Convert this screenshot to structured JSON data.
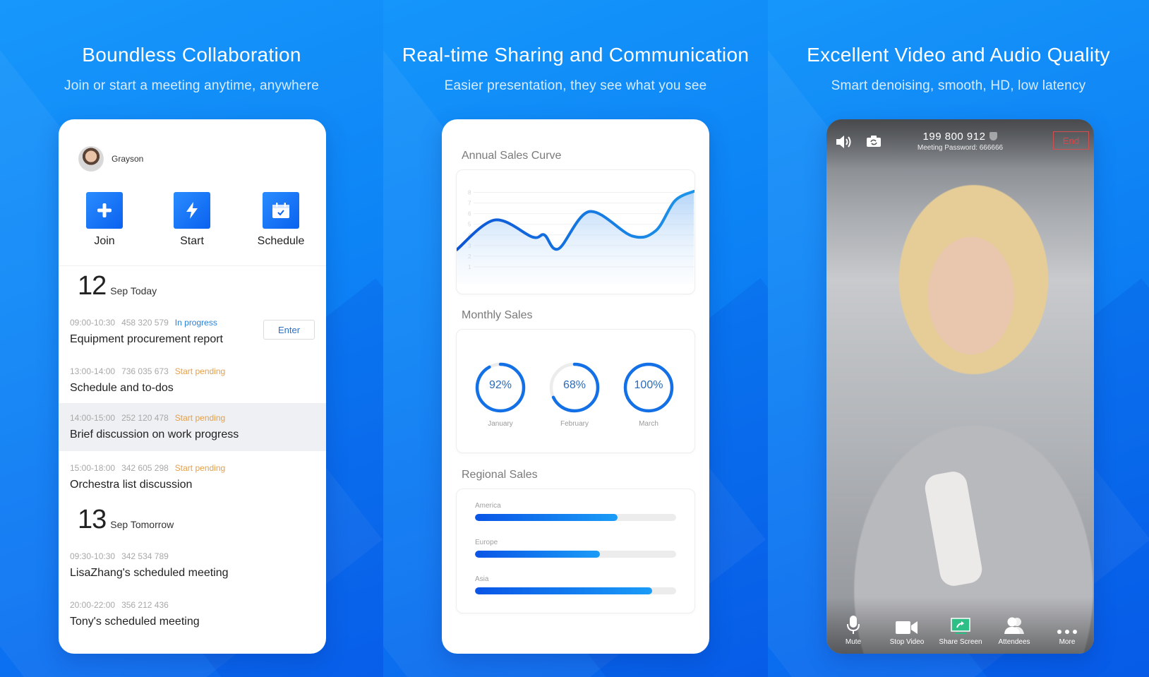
{
  "panels": [
    {
      "title": "Boundless Collaboration",
      "subtitle": "Join or start a meeting anytime, anywhere"
    },
    {
      "title": "Real-time Sharing and Communication",
      "subtitle": "Easier presentation, they see what you see"
    },
    {
      "title": "Excellent Video and Audio Quality",
      "subtitle": "Smart denoising, smooth, HD, low latency"
    }
  ],
  "home": {
    "user": {
      "name": "Grayson",
      "avatar_icon": "user-avatar"
    },
    "actions": [
      {
        "label": "Join",
        "icon": "plus-icon"
      },
      {
        "label": "Start",
        "icon": "lightning-icon"
      },
      {
        "label": "Schedule",
        "icon": "calendar-icon"
      }
    ],
    "days": [
      {
        "day": "12",
        "label": "Sep Today",
        "meetings": [
          {
            "time": "09:00-10:30",
            "id": "458 320 579",
            "status": "In progress",
            "title": "Equipment procurement report",
            "button": "Enter"
          },
          {
            "time": "13:00-14:00",
            "id": "736 035 673",
            "status": "Start pending",
            "title": "Schedule and to-dos"
          },
          {
            "time": "14:00-15:00",
            "id": "252 120 478",
            "status": "Start pending",
            "title": "Brief discussion on work progress",
            "highlighted": true
          },
          {
            "time": "15:00-18:00",
            "id": "342 605 298",
            "status": "Start pending",
            "title": "Orchestra list discussion"
          }
        ]
      },
      {
        "day": "13",
        "label": "Sep Tomorrow",
        "meetings": [
          {
            "time": "09:30-10:30",
            "id": "342 534 789",
            "status": "",
            "title": "LisaZhang's scheduled meeting"
          },
          {
            "time": "20:00-22:00",
            "id": "356 212 436",
            "status": "",
            "title": "Tony's scheduled meeting"
          }
        ]
      }
    ],
    "status_colors": {
      "In progress": "#2b7fd4",
      "Start pending": "#e4a04a"
    }
  },
  "dashboard": {
    "sections": {
      "annual": "Annual Sales Curve",
      "monthly": "Monthly Sales",
      "regional": "Regional Sales"
    },
    "accent": "#0a62ef"
  },
  "chart_data": [
    {
      "type": "area",
      "title": "Annual Sales Curve",
      "xlabel": "",
      "ylabel": "",
      "y_ticks": [
        "1",
        "2",
        "3",
        "4",
        "5",
        "6",
        "7",
        "8"
      ],
      "ylim": [
        0,
        8.5
      ],
      "grid": true,
      "x": [
        0,
        0.16,
        0.32,
        0.37,
        0.43,
        0.56,
        0.74,
        0.84,
        0.92,
        1.0
      ],
      "values": [
        2.6,
        5.4,
        3.8,
        4.0,
        2.7,
        6.2,
        3.9,
        4.4,
        7.2,
        8.1
      ]
    },
    {
      "type": "pie",
      "title": "Monthly Sales",
      "categories": [
        "January",
        "February",
        "March"
      ],
      "values": [
        92,
        68,
        100
      ],
      "labels": [
        "92%",
        "68%",
        "100%"
      ]
    },
    {
      "type": "bar",
      "title": "Regional Sales",
      "categories": [
        "America",
        "Europe",
        "Asia"
      ],
      "values": [
        71,
        62,
        88
      ],
      "ylim": [
        0,
        100
      ]
    }
  ],
  "call": {
    "meeting_id": "199 800 912",
    "password_label": "Meeting Password:",
    "password": "666666",
    "end_label": "End",
    "end_color": "#e04646",
    "controls": [
      {
        "label": "Mute",
        "icon": "microphone-icon"
      },
      {
        "label": "Stop Video",
        "icon": "video-camera-icon"
      },
      {
        "label": "Share Screen",
        "icon": "share-screen-icon"
      },
      {
        "label": "Attendees",
        "icon": "attendees-icon"
      },
      {
        "label": "More",
        "icon": "more-dots-icon"
      }
    ]
  }
}
